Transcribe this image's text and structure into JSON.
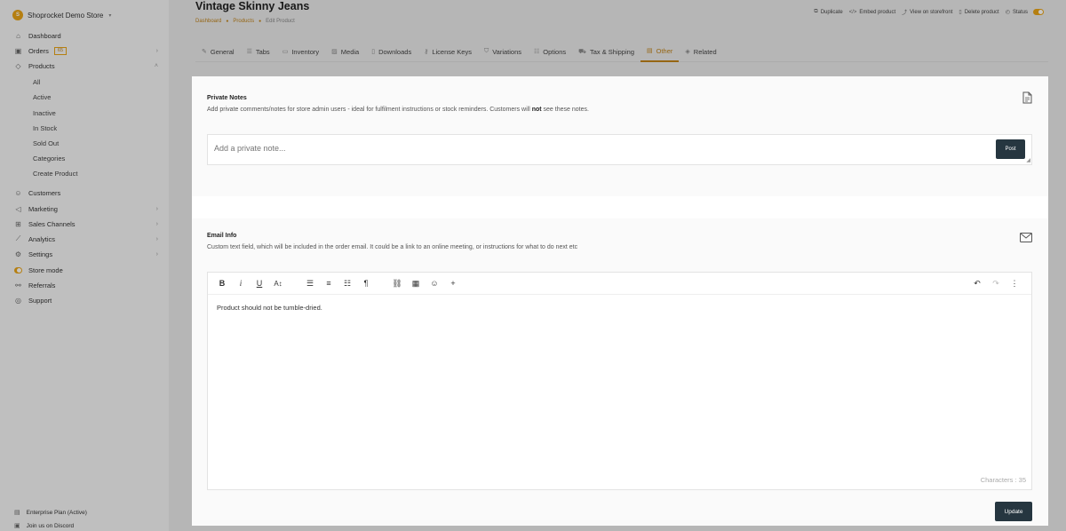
{
  "store": {
    "logo": "S",
    "name": "Shoprocket Demo Store"
  },
  "sidebar": {
    "items": [
      {
        "label": "Dashboard",
        "icon": "home-icon"
      },
      {
        "label": "Orders",
        "badge": "65",
        "icon": "box-icon"
      },
      {
        "label": "Products",
        "icon": "tag-icon"
      }
    ],
    "products_sub": [
      "All",
      "Active",
      "Inactive",
      "In Stock",
      "Sold Out",
      "Categories",
      "Create Product"
    ],
    "items2": [
      {
        "label": "Customers",
        "icon": "users-icon"
      },
      {
        "label": "Marketing",
        "icon": "megaphone-icon"
      },
      {
        "label": "Sales Channels",
        "icon": "channels-icon"
      },
      {
        "label": "Analytics",
        "icon": "chart-icon"
      },
      {
        "label": "Settings",
        "icon": "gear-icon"
      },
      {
        "label": "Store mode",
        "icon": "toggle-icon"
      },
      {
        "label": "Referrals",
        "icon": "referral-icon"
      },
      {
        "label": "Support",
        "icon": "support-icon"
      }
    ],
    "footer": [
      "Enterprise Plan (Active)",
      "Join us on Discord"
    ]
  },
  "header": {
    "title": "Vintage Skinny Jeans",
    "breadcrumbs": [
      "Dashboard",
      "Products",
      "Edit Product"
    ],
    "actions": [
      "Duplicate",
      "Embed product",
      "View on storefront",
      "Delete product",
      "Status"
    ]
  },
  "tabs": [
    "General",
    "Tabs",
    "Inventory",
    "Media",
    "Downloads",
    "License Keys",
    "Variations",
    "Options",
    "Tax & Shipping",
    "Other",
    "Related"
  ],
  "private_notes": {
    "title": "Private Notes",
    "desc_before": "Add private comments/notes for store admin users - ideal for fulfilment instructions or stock reminders. Customers will ",
    "desc_bold": "not",
    "desc_after": " see these notes.",
    "placeholder": "Add a private note...",
    "post_label": "Post"
  },
  "email_info": {
    "title": "Email Info",
    "desc": "Custom text field, which will be included in the order email. It could be a link to an online meeting, or instructions for what to do next etc",
    "content": "Product should not be tumble-dried.",
    "characters": "Characters : 35",
    "update_label": "Update"
  },
  "colors": {
    "accent": "#c0831a",
    "button": "#263640"
  }
}
